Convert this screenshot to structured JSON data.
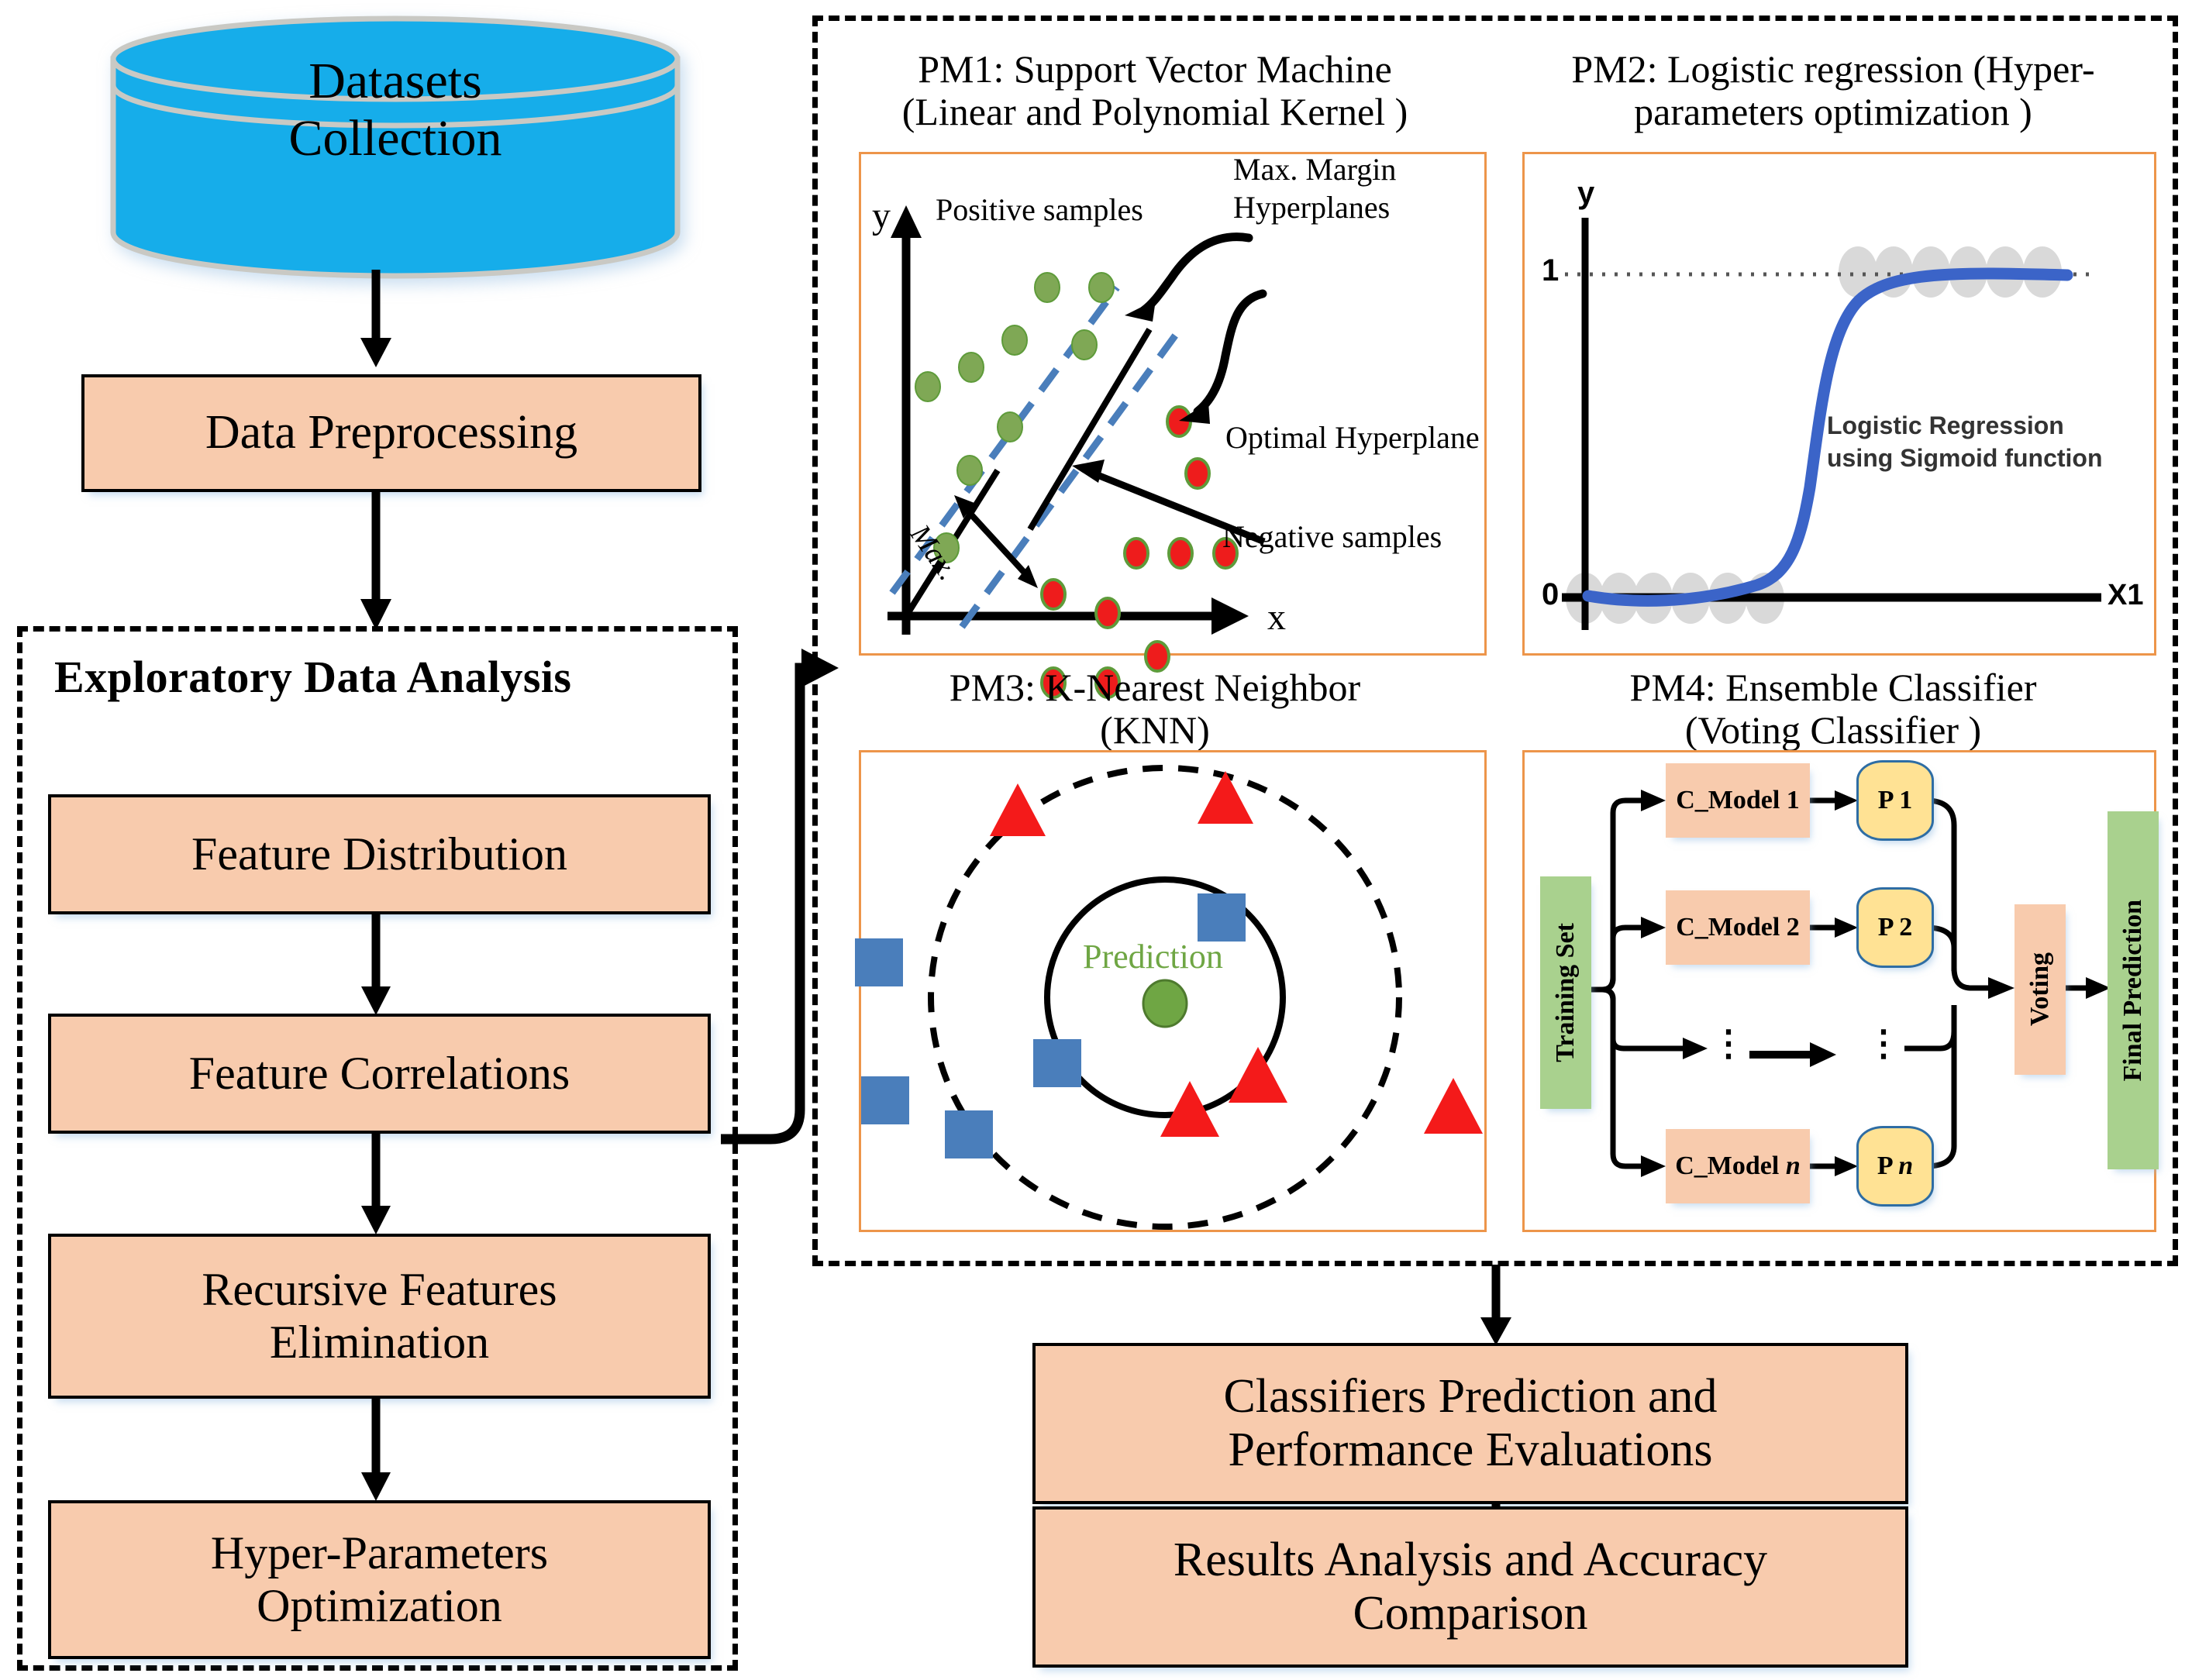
{
  "flow": {
    "datasets_collection": "Datasets\nCollection",
    "datasets_line1": "Datasets",
    "datasets_line2": "Collection",
    "data_preprocessing": "Data Preprocessing",
    "eda_title": "Exploratory Data Analysis",
    "eda_steps": [
      {
        "label": "Feature Distribution"
      },
      {
        "label": "Feature Correlations"
      },
      {
        "label_line1": "Recursive Features",
        "label_line2": "Elimination"
      },
      {
        "label_line1": "Hyper-Parameters",
        "label_line2": "Optimization"
      }
    ],
    "classifiers_eval_line1": "Classifiers Prediction and",
    "classifiers_eval_line2": "Performance Evaluations",
    "results_line1": "Results Analysis and Accuracy",
    "results_line2": "Comparison"
  },
  "prediction_models": {
    "pm1": {
      "title_line1": "PM1: Support Vector Machine",
      "title_line2": "(Linear and Polynomial Kernel )",
      "axis_y": "y",
      "axis_x": "x",
      "label_positive": "Positive samples",
      "label_negative": "Negative samples",
      "label_max_margin_line1": "Max. Margin",
      "label_max_margin_line2": "Hyperplanes",
      "label_optimal": "Optimal Hyperplane",
      "label_max": "Max.",
      "colors": {
        "positive_point": "#7FA855",
        "negative_point": "#EE1C1C",
        "negative_stroke": "#5E9B3A",
        "hyperplane_dashed": "#4A7EBB",
        "optimal_line": "#000000"
      }
    },
    "pm2": {
      "title_line1": "PM2: Logistic regression (Hyper-",
      "title_line2": "parameters optimization )",
      "axis_y": "y",
      "axis_x": "X1",
      "tick_one": "1",
      "tick_zero": "0",
      "annotation_line1": "Logistic Regression",
      "annotation_line2": "using Sigmoid function",
      "colors": {
        "curve": "#3B64C8",
        "points": "#D9D9D9"
      }
    },
    "pm3": {
      "title_line1": "PM3: K-Nearest Neighbor",
      "title_line2": "(KNN)",
      "prediction_label": "Prediction",
      "colors": {
        "triangle": "#F41A1A",
        "square": "#4A7EBB",
        "center_dot": "#6FA644",
        "prediction_text": "#6FA644"
      }
    },
    "pm4": {
      "title_line1": "PM4: Ensemble Classifier",
      "title_line2": "(Voting Classifier )",
      "training_set": "Training Set",
      "models": [
        "C_Model 1",
        "C_Model 2",
        "C_Model n"
      ],
      "model_n_prefix": "C_Model ",
      "model_n_italic": "n",
      "predictions": [
        "P 1",
        "P 2",
        "P n"
      ],
      "pred_n_prefix": "P ",
      "pred_n_italic": "n",
      "voting": "Voting",
      "final_prediction": "Final Prediction",
      "ellipsis": "⋮",
      "colors": {
        "training_set": "#A9D18E",
        "model_box": "#F8CBAD",
        "prediction_box": "#FFE294",
        "prediction_stroke": "#2E6DA4",
        "voting_box": "#F8CBAD",
        "final_box": "#A9D18E"
      }
    }
  },
  "palette": {
    "cylinder": "#16ADEA",
    "cylinder_edge": "#C9C9C4",
    "process_fill": "#F8CBAD",
    "process_border": "#000000",
    "panel_border": "#ED954A",
    "dashed_border": "#000000"
  }
}
